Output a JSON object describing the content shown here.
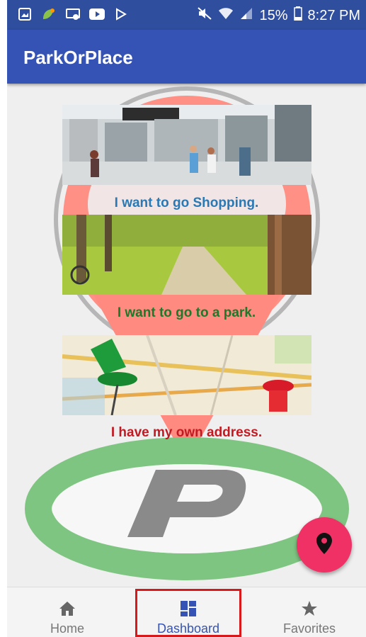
{
  "status_bar": {
    "battery": "15%",
    "time": "8:27 PM"
  },
  "app_bar": {
    "title": "ParkOrPlace"
  },
  "options": [
    {
      "label": "I want to go Shopping.",
      "color": "#2a78b4",
      "image": "shopping-mall-photo"
    },
    {
      "label": "I want to go to a park.",
      "color": "#1c7a2c",
      "image": "park-path-photo"
    },
    {
      "label": "I have my own address.",
      "color": "#c21a22",
      "image": "map-pins-photo"
    }
  ],
  "fab": {
    "icon": "location-pin-icon",
    "color": "#f03166"
  },
  "bottom_nav": {
    "items": [
      {
        "label": "Home",
        "icon": "home-icon"
      },
      {
        "label": "Dashboard",
        "icon": "dashboard-icon",
        "active": true
      },
      {
        "label": "Favorites",
        "icon": "star-icon"
      }
    ]
  },
  "colors": {
    "primary": "#3553b5",
    "status_bar": "#2f4e9e",
    "logo_pin": "#ff8a80",
    "logo_ring": "#7fc582"
  }
}
